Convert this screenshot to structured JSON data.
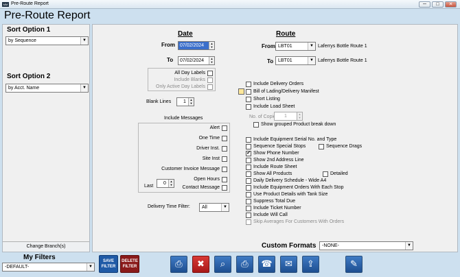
{
  "window": {
    "title": "Pre-Route Report",
    "icon": "app-icon"
  },
  "page_title": "Pre-Route Report",
  "sidebar": {
    "sort1": {
      "label": "Sort Option 1",
      "value": "by Sequence"
    },
    "sort2": {
      "label": "Sort Option 2",
      "value": "by Acct. Name"
    },
    "change_branch": "Change Branch(s)"
  },
  "date": {
    "header": "Date",
    "from_label": "From",
    "from_value": "07/02/2024",
    "to_label": "To",
    "to_value": "07/02/2024",
    "all_day": "All Day Labels",
    "include_blanks": "Include Blanks",
    "only_active": "Only Active Day Labels",
    "blank_lines_label": "Blank Lines",
    "blank_lines_value": "1"
  },
  "messages": {
    "header": "Include Messages",
    "items": [
      "Alert",
      "One Time",
      "Driver Inst.",
      "Site Inst",
      "Customer Invoice Message",
      "Open Hours",
      "Contact Message"
    ],
    "last_label": "Last",
    "last_value": "0"
  },
  "delivery": {
    "label": "Delivery Time Filter:",
    "value": "All"
  },
  "route": {
    "header": "Route",
    "from_label": "From",
    "from_value": "LBT01",
    "from_name": "Laferrys Bottle Route 1",
    "to_label": "To",
    "to_value": "LBT01",
    "to_name": "Laferrys Bottle Route 1"
  },
  "options": {
    "include_delivery": "Include Delivery Orders",
    "bill_of_lading": "Bill of Lading/Delivery Manifest",
    "short_listing": "Short Listing",
    "include_load_sheet": "Include Load Sheet",
    "copies_label": "No. of Copies",
    "copies_value": "1",
    "show_grouped": "Show grouped Product break down",
    "equip_serial": "Include Equipment Serial No. and Type",
    "seq_special": "Sequence Special Stops",
    "seq_drags": "Sequence Drags",
    "show_phone": "Show Phone Number",
    "show_addr2": "Show 2nd Address Line",
    "include_route_sheet": "Include Route Sheet",
    "show_all_products": "Show All Products",
    "detailed": "Detailed",
    "daily_delivery": "Daily  Delivery Schedule - Wide A4",
    "equip_orders": "Include Equipment Orders With Each Stop",
    "use_product": "Use Product Details with Tank Size",
    "suppress_total": "Suppress Total Due",
    "include_ticket": "Include Ticket Number",
    "include_will_call": "Include Will Call",
    "skip_averages": "Skip Averages For Customers With Orders",
    "checkmark": "✔"
  },
  "custom_formats": {
    "label": "Custom Formats",
    "value": "-NONE-"
  },
  "filters": {
    "label": "My Filters",
    "value": "-DEFAULT-",
    "save": "SAVE FILTER",
    "delete": "DELETE FILTER"
  },
  "toolbar": {
    "print_icon": "printer-icon",
    "cancel_icon": "close-x-icon",
    "search_icon": "magnifier-icon",
    "preview_icon": "print-preview-icon",
    "fax_icon": "fax-icon",
    "email_icon": "envelope-icon",
    "upload_icon": "upload-icon",
    "edit_icon": "edit-document-icon"
  },
  "colors": {
    "accent": "#1d4e90",
    "background": "#cde0ef",
    "save": "#1f5aa6",
    "delete": "#8a1a1a",
    "cancel": "#c0201f"
  }
}
